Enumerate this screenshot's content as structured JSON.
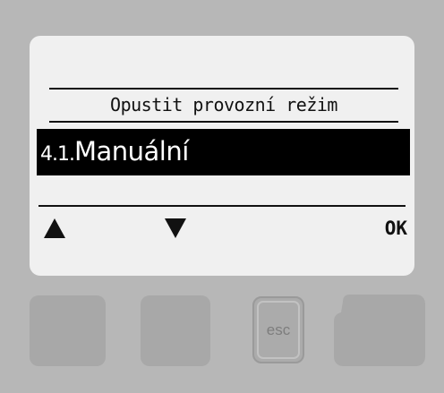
{
  "display": {
    "title": "Opustit provozní režim",
    "selected_item": {
      "number": "4.1.",
      "label": "Manuální"
    },
    "softkeys": {
      "up_icon": "triangle-up-icon",
      "down_icon": "triangle-down-icon",
      "ok_label": "OK"
    }
  },
  "hardware_buttons": {
    "esc_label": "esc"
  },
  "colors": {
    "housing": "#b7b7b7",
    "lcd_background": "#f0f0f0",
    "lcd_ink": "#111111",
    "selection_background": "#000000",
    "button": "#a8a8a8"
  }
}
